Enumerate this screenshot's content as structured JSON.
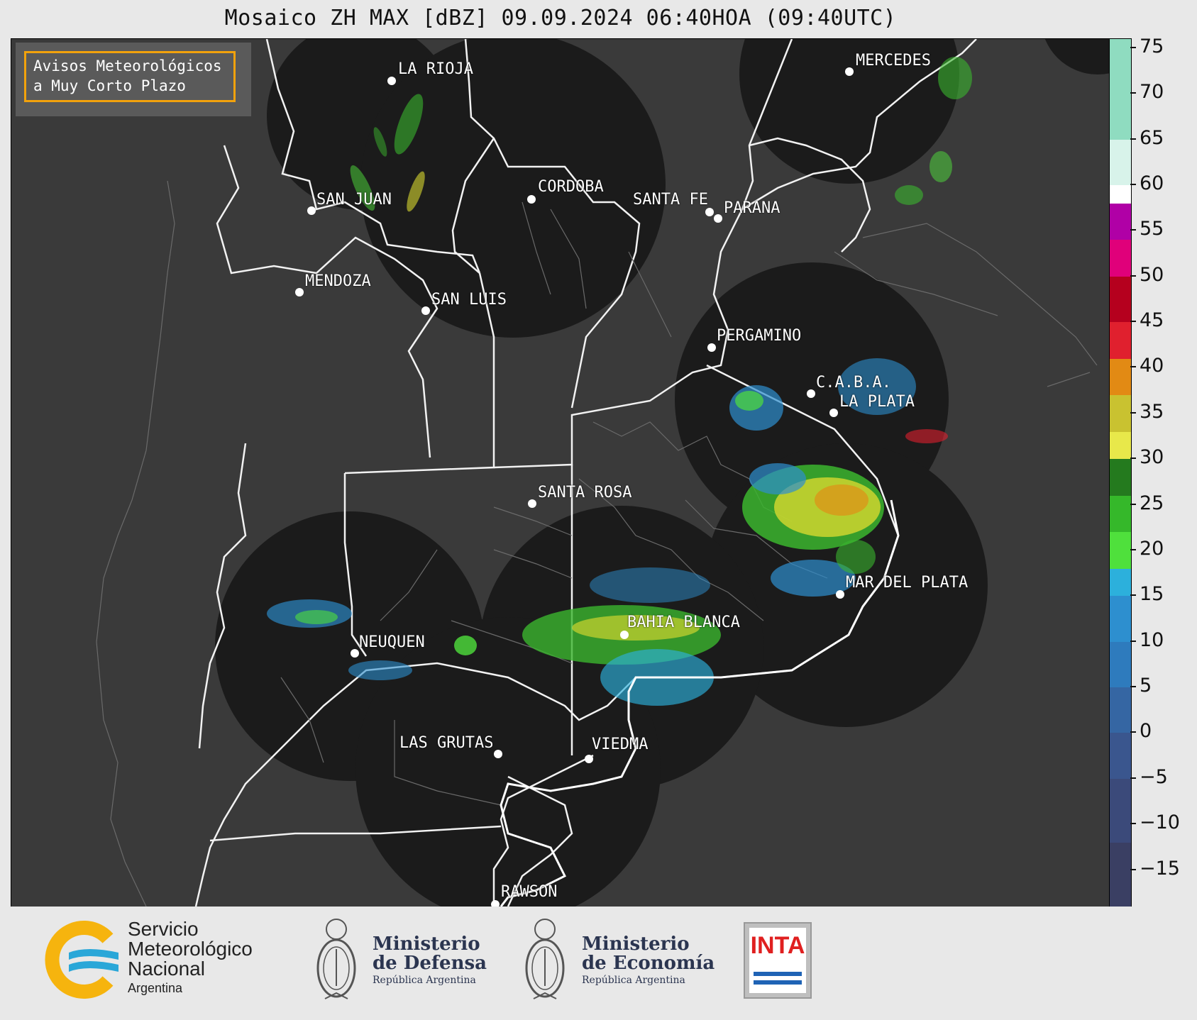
{
  "title": "Mosaico ZH MAX [dBZ] 09.09.2024 06:40HOA (09:40UTC)",
  "notice": {
    "line1": "Avisos Meteorológicos",
    "line2": "a Muy Corto Plazo"
  },
  "cities": [
    {
      "name": "LA RIOJA"
    },
    {
      "name": "MERCEDES"
    },
    {
      "name": "SAN JUAN"
    },
    {
      "name": "CORDOBA"
    },
    {
      "name": "SANTA FE"
    },
    {
      "name": "PARANA"
    },
    {
      "name": "MENDOZA"
    },
    {
      "name": "SAN LUIS"
    },
    {
      "name": "PERGAMINO"
    },
    {
      "name": "C.A.B.A."
    },
    {
      "name": "LA PLATA"
    },
    {
      "name": "SANTA ROSA"
    },
    {
      "name": "MAR DEL PLATA"
    },
    {
      "name": "BAHIA BLANCA"
    },
    {
      "name": "NEUQUEN"
    },
    {
      "name": "LAS GRUTAS"
    },
    {
      "name": "VIEDMA"
    },
    {
      "name": "RAWSON"
    }
  ],
  "colorbar": {
    "ticks": [
      "75",
      "70",
      "65",
      "60",
      "55",
      "50",
      "45",
      "40",
      "35",
      "30",
      "25",
      "20",
      "15",
      "10",
      "5",
      "0",
      "−5",
      "−10",
      "−15"
    ],
    "min": -19,
    "max": 76,
    "bands": [
      {
        "from": -19,
        "to": -12,
        "color": "#3a3f63"
      },
      {
        "from": -12,
        "to": -5,
        "color": "#3b4a7a"
      },
      {
        "from": -5,
        "to": 0,
        "color": "#3a568e"
      },
      {
        "from": 0,
        "to": 5,
        "color": "#3566a3"
      },
      {
        "from": 5,
        "to": 10,
        "color": "#2e7bbd"
      },
      {
        "from": 10,
        "to": 15,
        "color": "#2d8fcf"
      },
      {
        "from": 15,
        "to": 18,
        "color": "#2cb0dc"
      },
      {
        "from": 18,
        "to": 22,
        "color": "#4fe03c"
      },
      {
        "from": 22,
        "to": 26,
        "color": "#35b82a"
      },
      {
        "from": 26,
        "to": 30,
        "color": "#247a1e"
      },
      {
        "from": 30,
        "to": 33,
        "color": "#e8e84a"
      },
      {
        "from": 33,
        "to": 37,
        "color": "#c9c230"
      },
      {
        "from": 37,
        "to": 41,
        "color": "#e28a14"
      },
      {
        "from": 41,
        "to": 45,
        "color": "#e0202e"
      },
      {
        "from": 45,
        "to": 50,
        "color": "#b5001e"
      },
      {
        "from": 50,
        "to": 54,
        "color": "#e0007a"
      },
      {
        "from": 54,
        "to": 58,
        "color": "#b000a6"
      },
      {
        "from": 58,
        "to": 60,
        "color": "#ffffff"
      },
      {
        "from": 60,
        "to": 65,
        "color": "#d8f3ea"
      },
      {
        "from": 65,
        "to": 76,
        "color": "#8fdcc0"
      }
    ]
  },
  "footer": {
    "smn": [
      "Servicio",
      "Meteorológico",
      "Nacional"
    ],
    "smn_country": "Argentina",
    "defensa": [
      "Ministerio",
      "de Defensa"
    ],
    "defensa_sub": "República Argentina",
    "economia": [
      "Ministerio",
      "de Economía"
    ],
    "economia_sub": "República Argentina",
    "inta": "INTA"
  }
}
